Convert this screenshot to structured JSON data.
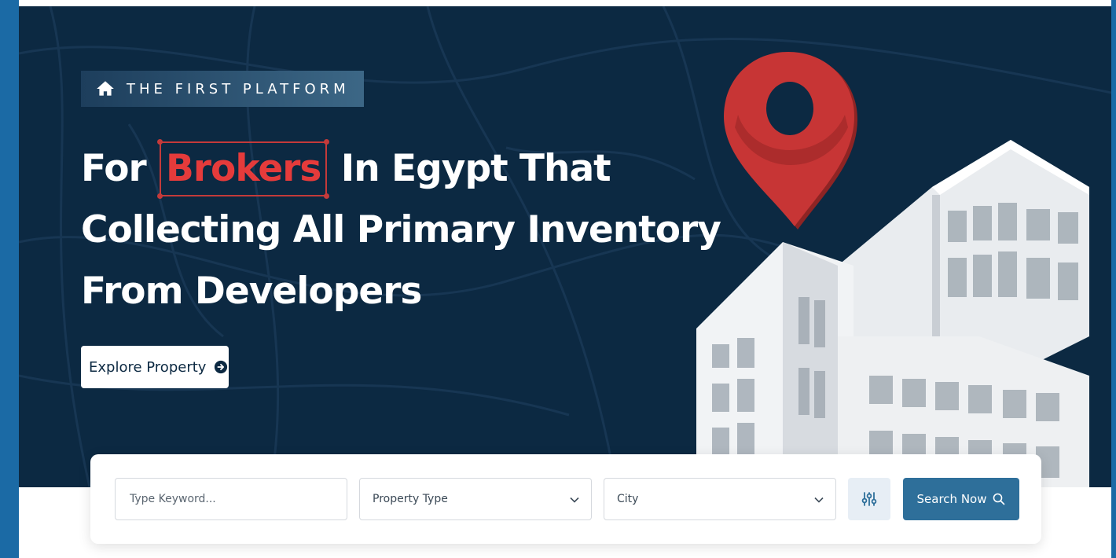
{
  "hero": {
    "tag_label": "THE FIRST PLATFORM",
    "tag_icon": "home-icon",
    "headline": {
      "line1_before": "For",
      "line1_highlight": "Brokers",
      "line1_after": "In Egypt That",
      "line2": "Collecting All Primary Inventory",
      "line3": "From Developers"
    },
    "cta_label": "Explore Property",
    "cta_icon": "arrow-right-circle-icon"
  },
  "search": {
    "keyword_placeholder": "Type Keyword...",
    "property_type_label": "Property Type",
    "city_label": "City",
    "filter_icon": "sliders-icon",
    "search_label": "Search Now",
    "search_icon": "search-icon"
  },
  "colors": {
    "hero_bg": "#0c2942",
    "accent_red": "#e53b3b",
    "search_button": "#2e6f9a",
    "side_bar": "#1b6aa5"
  }
}
